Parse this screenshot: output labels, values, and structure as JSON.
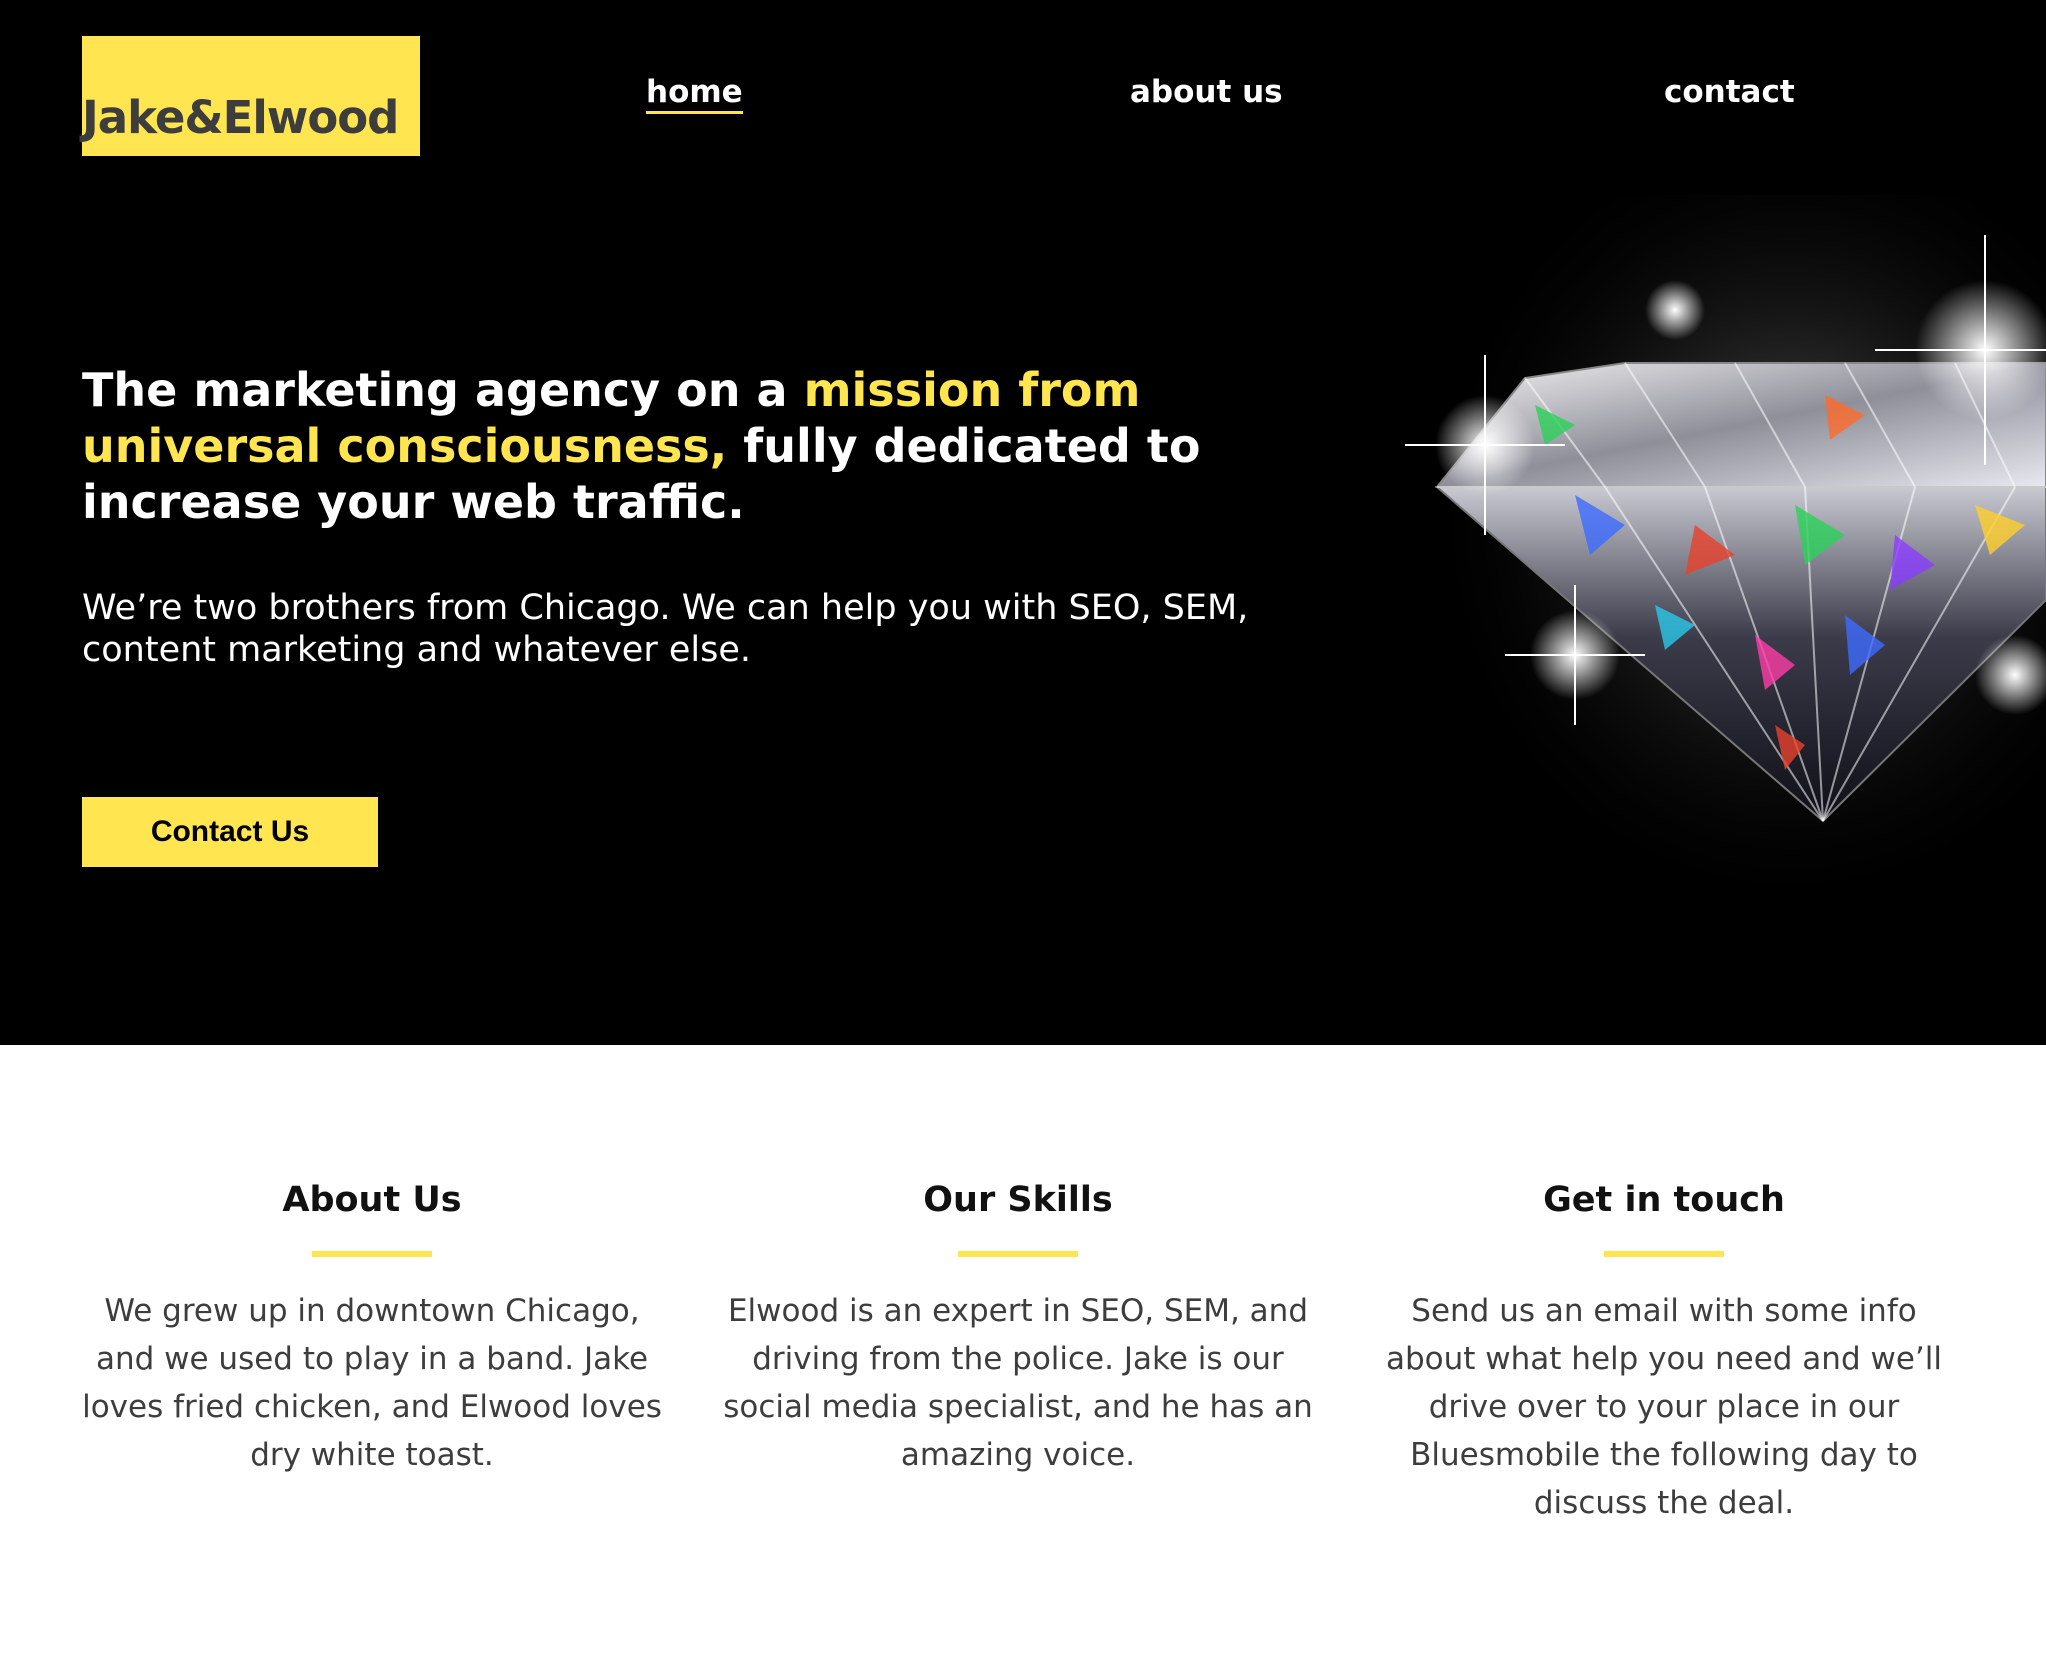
{
  "brand": {
    "logo_text": "Jake&Elwood",
    "accent_color": "#ffe54f"
  },
  "nav": {
    "items": [
      {
        "label": "home",
        "active": true
      },
      {
        "label": "about us",
        "active": false
      },
      {
        "label": "contact",
        "active": false
      }
    ]
  },
  "hero": {
    "headline_part1": "The marketing agency on a ",
    "headline_highlight": "mission from universal consciousness,",
    "headline_part2": " fully dedicated to increase your web traffic.",
    "subheadline": "We’re two brothers from Chicago. We can help you with SEO, SEM, content marketing and whatever else.",
    "cta_label": "Contact Us",
    "image": "diamond"
  },
  "features": [
    {
      "title": "About Us",
      "text": "We grew up in downtown Chicago, and we used to play in a band. Jake loves fried chicken, and Elwood loves dry white toast."
    },
    {
      "title": "Our Skills",
      "text": "Elwood is an expert in SEO, SEM, and driving from the police. Jake is our social media specialist, and he has an amazing voice."
    },
    {
      "title": "Get in touch",
      "text": "Send us an email with some info about what help you need and we’ll drive over to your place in our Bluesmobile the following day to discuss the deal."
    }
  ]
}
